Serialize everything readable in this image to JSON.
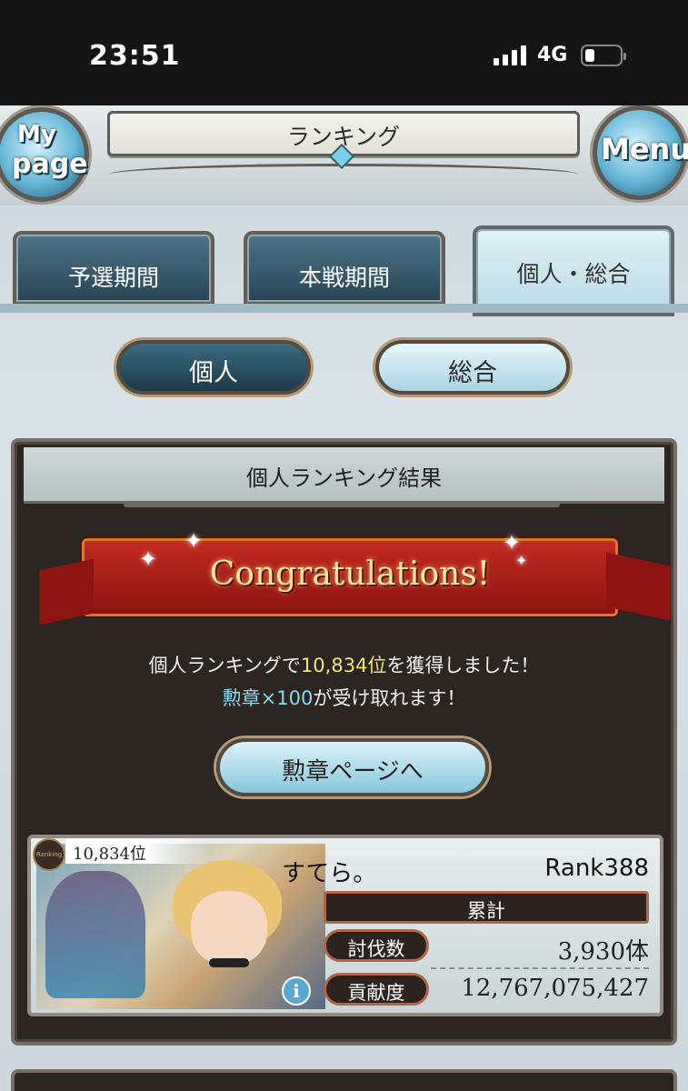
{
  "status_bar": {
    "time": "23:51",
    "network": "4G"
  },
  "header": {
    "title": "ランキング",
    "mypage_line1": "My",
    "mypage_line2": "page",
    "menu_label": "Menu"
  },
  "tabs": [
    {
      "label": "予選期間",
      "active": false
    },
    {
      "label": "本戦期間",
      "active": false
    },
    {
      "label": "個人・総合",
      "active": true
    }
  ],
  "subtabs": [
    {
      "label": "個人",
      "active": true
    },
    {
      "label": "総合",
      "active": false
    }
  ],
  "panel": {
    "title": "個人ランキング結果",
    "banner": "Congratulations!",
    "message_line1": {
      "prefix": "個人ランキングで",
      "rank": "10,834位",
      "suffix": "を獲得しました！"
    },
    "message_line2": {
      "reward": "勲章×100",
      "suffix": "が受け取れます！"
    },
    "medal_button": "勲章ページへ"
  },
  "player_card": {
    "rank_emblem": "Ranking",
    "rank_position": "10,834位",
    "name": "すてら。",
    "player_rank": "Rank388",
    "cumulative_label": "累計",
    "stats": [
      {
        "label": "討伐数",
        "value": "3,930体"
      },
      {
        "label": "貢献度",
        "value": "12,767,075,427"
      }
    ]
  },
  "colors": {
    "highlight_yellow": "#f4e27a",
    "highlight_blue": "#8fd5ef",
    "banner_red": "#c22a22"
  }
}
